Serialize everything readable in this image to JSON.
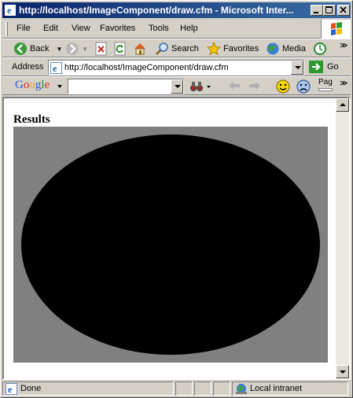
{
  "window": {
    "title": "http://localhost/ImageComponent/draw.cfm - Microsoft Internet Explorer",
    "title_shown": "http://localhost/ImageComponent/draw.cfm - Microsoft Inter..."
  },
  "menu": {
    "items": [
      {
        "label": "File"
      },
      {
        "label": "Edit"
      },
      {
        "label": "View"
      },
      {
        "label": "Favorites"
      },
      {
        "label": "Tools"
      },
      {
        "label": "Help"
      }
    ]
  },
  "toolbar": {
    "back_label": "Back",
    "search_label": "Search",
    "favorites_label": "Favorites",
    "media_label": "Media",
    "icons": [
      "back-icon",
      "forward-icon",
      "stop-icon",
      "refresh-icon",
      "home-icon",
      "search-icon",
      "favorites-icon",
      "media-icon",
      "history-icon"
    ]
  },
  "address": {
    "label": "Address",
    "url": "http://localhost/ImageComponent/draw.cfm",
    "go_label": "Go"
  },
  "google_toolbar": {
    "logo": "Google",
    "search_value": "",
    "page_label": "Pag"
  },
  "page": {
    "heading": "Results",
    "image": {
      "background_color": "#808080",
      "ellipse_color": "#000000"
    }
  },
  "status": {
    "text": "Done",
    "zone": "Local intranet"
  },
  "colors": {
    "titlebar_start": "#0a246a",
    "titlebar_end": "#3a6ea5",
    "chrome": "#d4d0c8"
  }
}
